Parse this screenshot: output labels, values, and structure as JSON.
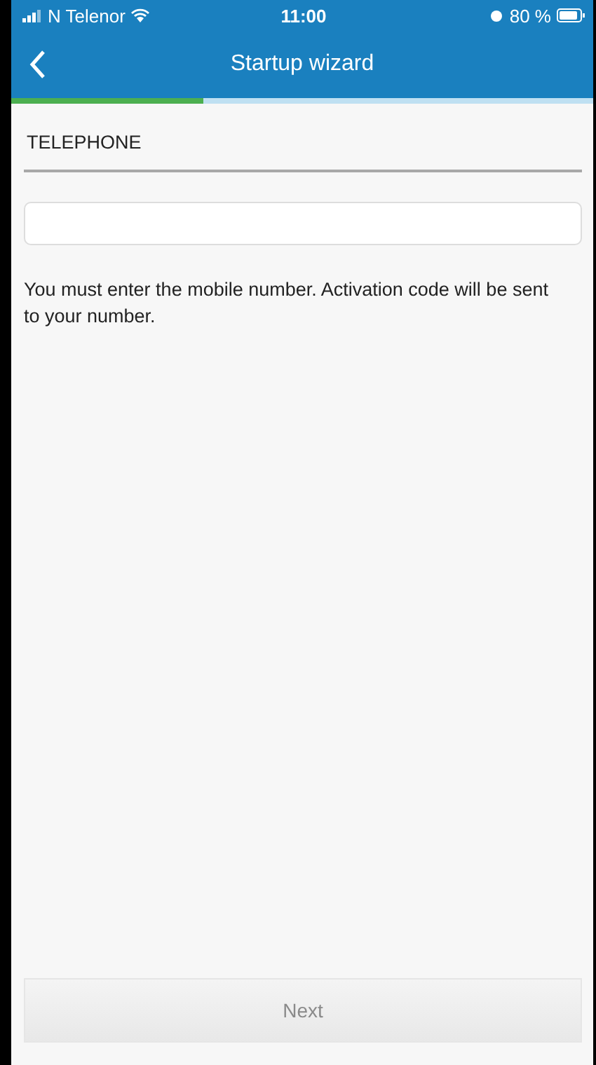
{
  "status_bar": {
    "carrier": "N Telenor",
    "time": "11:00",
    "battery": "80 %"
  },
  "nav_bar": {
    "title": "Startup wizard"
  },
  "progress": {
    "level": 0.33
  },
  "section": {
    "title": "TELEPHONE"
  },
  "hint": "You must enter the mobile number. Activation code will be sent to your number.",
  "next_button": {
    "label": "Next",
    "disabled": true
  }
}
